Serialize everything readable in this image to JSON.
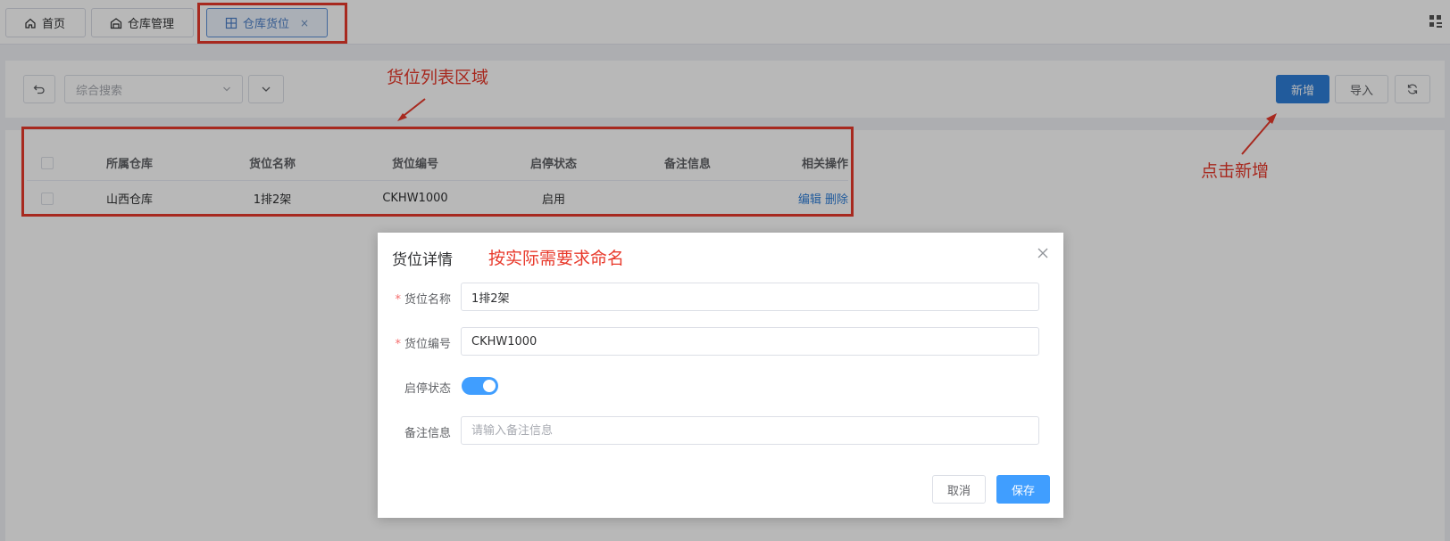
{
  "tabs": [
    {
      "label": "首页",
      "icon": "home-icon"
    },
    {
      "label": "仓库管理",
      "icon": "warehouse-icon"
    },
    {
      "label": "仓库货位",
      "icon": "grid-icon",
      "close": "×"
    }
  ],
  "toolbar": {
    "search_placeholder": "综合搜索",
    "add_label": "新增",
    "import_label": "导入"
  },
  "table": {
    "headers": [
      "所属仓库",
      "货位名称",
      "货位编号",
      "启停状态",
      "备注信息",
      "相关操作"
    ],
    "rows": [
      {
        "warehouse": "山西仓库",
        "name": "1排2架",
        "code": "CKHW1000",
        "status": "启用",
        "remark": "",
        "edit": "编辑",
        "delete": "删除"
      }
    ]
  },
  "annotations": {
    "list_area": "货位列表区域",
    "click_add": "点击新增",
    "naming": "按实际需要求命名"
  },
  "dialog": {
    "title": "货位详情",
    "fields": {
      "name_label": "货位名称",
      "name_value": "1排2架",
      "code_label": "货位编号",
      "code_value": "CKHW1000",
      "status_label": "启停状态",
      "status_on": true,
      "remark_label": "备注信息",
      "remark_placeholder": "请输入备注信息"
    },
    "cancel_label": "取消",
    "save_label": "保存",
    "required_mark": "*"
  },
  "colors": {
    "primary": "#2f7ed8",
    "switch_on": "#409eff",
    "annotation": "#e8392b"
  }
}
